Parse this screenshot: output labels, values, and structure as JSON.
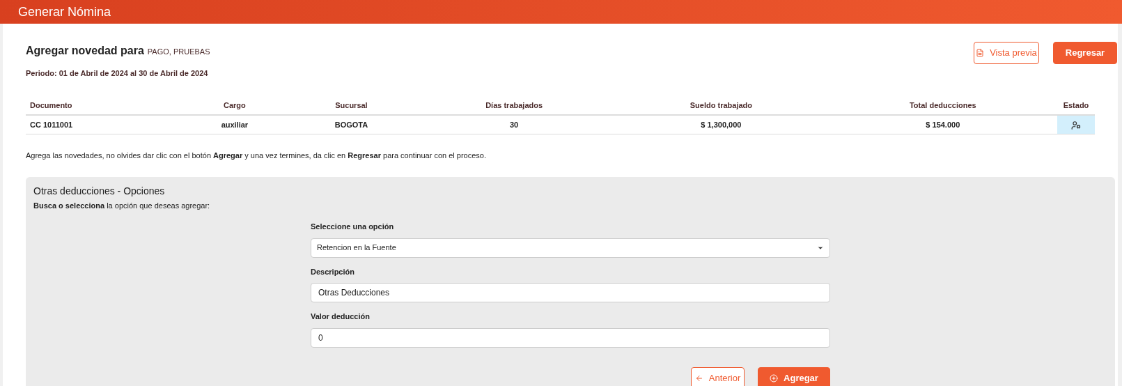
{
  "header": {
    "title": "Generar Nómina"
  },
  "heading": {
    "title": "Agregar novedad para",
    "employee": "PAGO, PRUEBAS",
    "period": "Periodo: 01 de Abril de 2024 al 30 de Abril de 2024"
  },
  "actions": [
    {
      "kind": "outline",
      "label": "Vista previa"
    },
    {
      "kind": "solid",
      "label": "Regresar"
    }
  ],
  "table": {
    "columns": [
      "Documento",
      "Cargo",
      "Sucursal",
      "Días trabajados",
      "Sueldo trabajado",
      "Total deducciones",
      "Estado"
    ],
    "rows": [
      {
        "cells": [
          "CC 1011001",
          "auxiliar",
          "BOGOTA",
          "30",
          "$ 1,300,000",
          "$ 154.000"
        ]
      }
    ]
  },
  "instructions": "Agrega las novedades, no olvides dar clic con el botón **Agregar** y una vez termines, da clic en **Regresar** para continuar con el proceso.",
  "panel": {
    "title": "Otras deducciones - Opciones",
    "hint": "**Busca o selecciona** la opción que deseas agregar:",
    "fields": [
      {
        "kind": "select",
        "label": "Seleccione una opción",
        "value": "Retencion en la Fuente"
      },
      {
        "kind": "text",
        "label": "Descripción",
        "value": "Otras Deducciones"
      },
      {
        "kind": "text",
        "label": "Valor deducción",
        "value": "0"
      }
    ],
    "buttons": [
      {
        "kind": "outline",
        "label": "Anterior"
      },
      {
        "kind": "solid",
        "label": "Agregar"
      }
    ]
  }
}
